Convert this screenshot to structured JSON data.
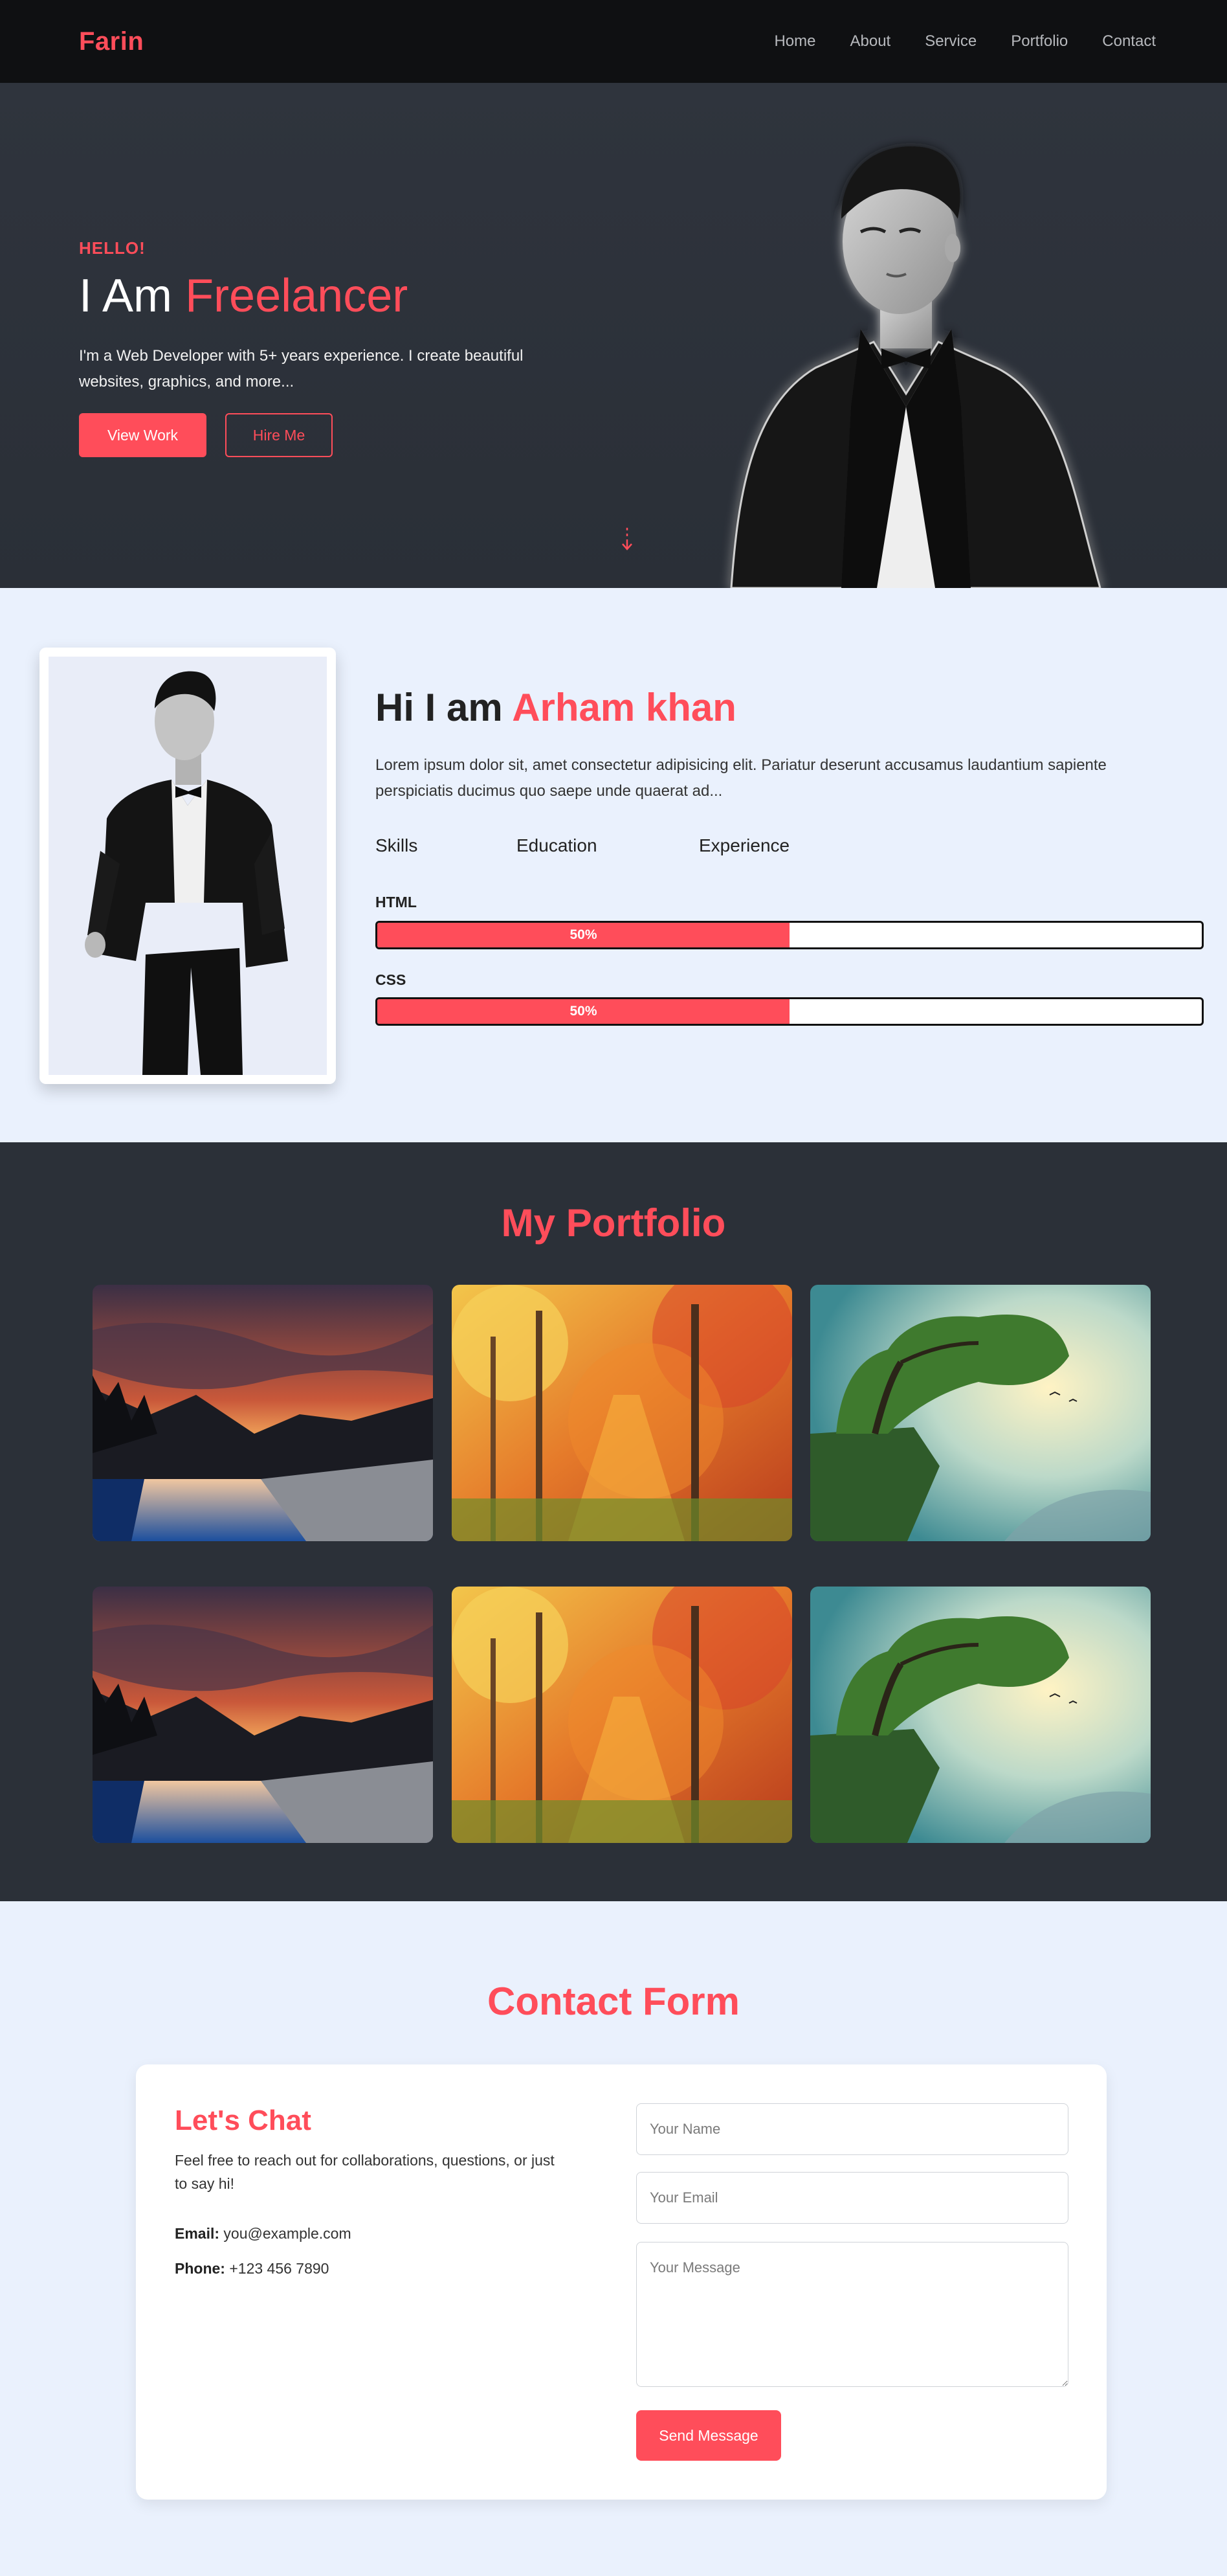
{
  "nav": {
    "logo": "Farin",
    "links": [
      "Home",
      "About",
      "Service",
      "Portfolio",
      "Contact"
    ]
  },
  "hero": {
    "greeting": "HELLO!",
    "title_prefix": "I Am",
    "title_accent": "Freelancer",
    "description": "I'm a Web Developer with 5+ years experience. I create beautiful websites, graphics, and more...",
    "primary_button": "View Work",
    "secondary_button": "Hire Me",
    "scroll_icon": "arrow-down-icon"
  },
  "about": {
    "title_prefix": "Hi I am",
    "title_accent": "Arham khan",
    "text": "Lorem ipsum dolor sit, amet consectetur adipisicing elit. Pariatur deserunt accusamus laudantium sapiente perspiciatis ducimus quo saepe unde quaerat ad...",
    "tabs": [
      "Skills",
      "Education",
      "Experience"
    ],
    "skills": [
      {
        "name": "HTML",
        "percent": 50,
        "label": "50%"
      },
      {
        "name": "CSS",
        "percent": 50,
        "label": "50%"
      }
    ]
  },
  "portfolio": {
    "title": "My Portfolio",
    "items": [
      {
        "scene": "mountain-lake-sunset"
      },
      {
        "scene": "autumn-forest"
      },
      {
        "scene": "cliff-tree-sky"
      },
      {
        "scene": "mountain-lake-sunset"
      },
      {
        "scene": "autumn-forest"
      },
      {
        "scene": "cliff-tree-sky"
      }
    ]
  },
  "contact": {
    "title": "Contact Form",
    "chat_title": "Let's Chat",
    "chat_desc": "Feel free to reach out for collaborations, questions, or just to say hi!",
    "email_label": "Email:",
    "email_value": "you@example.com",
    "phone_label": "Phone:",
    "phone_value": "+123 456 7890",
    "name_placeholder": "Your Name",
    "email_placeholder": "Your Email",
    "message_placeholder": "Your Message",
    "submit_label": "Send Message"
  },
  "colors": {
    "accent": "#ff4d5a",
    "nav_bg": "#0f1012",
    "hero_bg": "#2f343d",
    "portfolio_bg": "#2b3038",
    "light_bg": "#eaf1fd"
  }
}
